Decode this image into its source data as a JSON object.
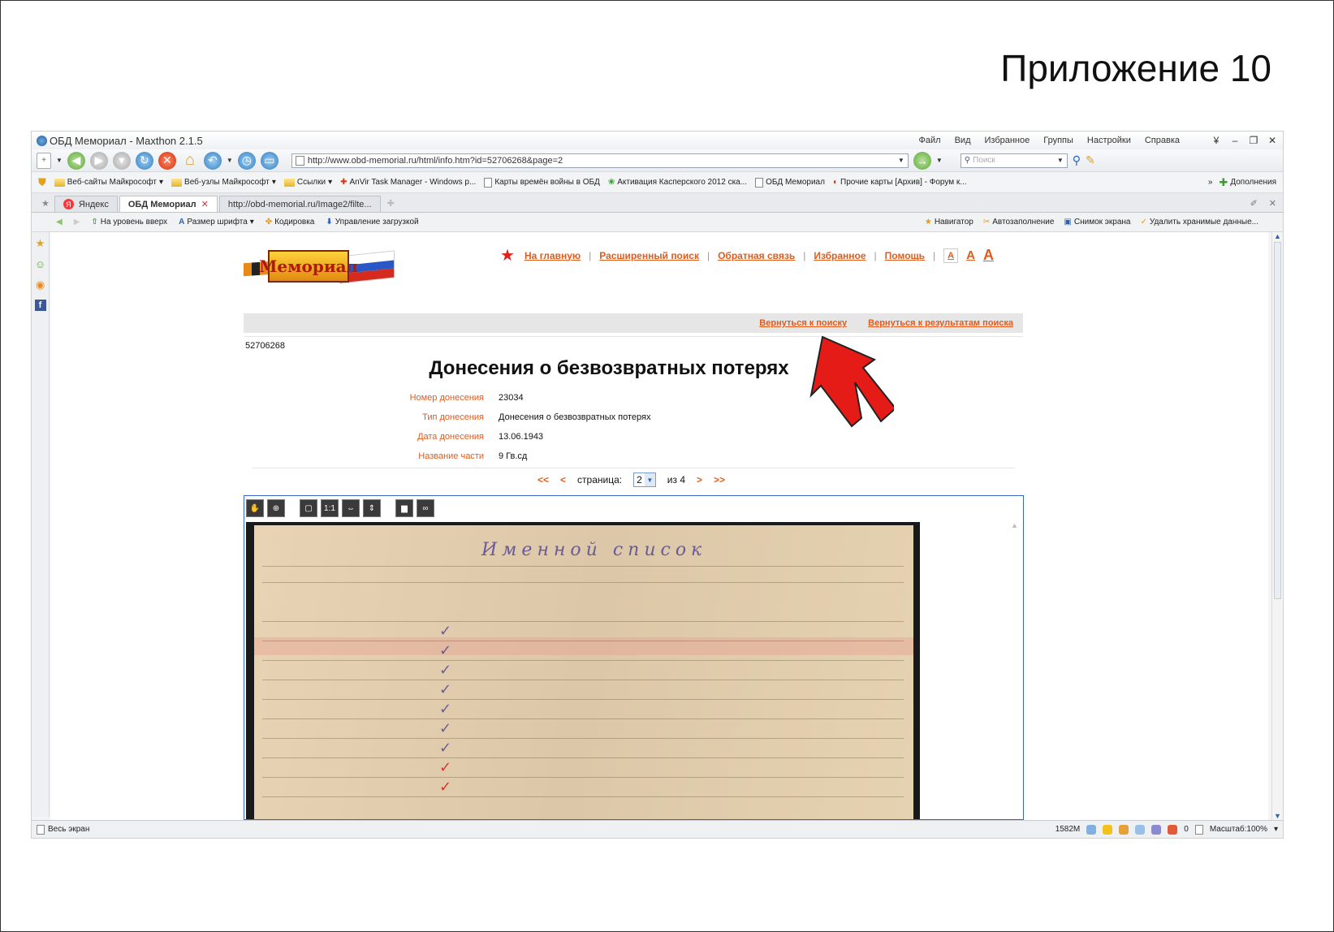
{
  "slide": {
    "title": "Приложение 10"
  },
  "browser": {
    "window_title": "ОБД Мемориал - Maxthon 2.1.5",
    "menu": [
      "Файл",
      "Вид",
      "Избранное",
      "Группы",
      "Настройки",
      "Справка"
    ],
    "address": "http://www.obd-memorial.ru/html/info.htm?id=52706268&page=2",
    "search_placeholder": "Поиск",
    "bookmarks": [
      "Веб-сайты Майкрософт",
      "Веб-узлы Майкрософт",
      "Ссылки",
      "AnVir Task Manager - Windows p...",
      "Карты времён войны в ОБД",
      "Активация Касперского 2012 ска...",
      "ОБД Мемориал",
      "Прочие карты [Архив] - Форум к..."
    ],
    "bookmarks_extra": "Дополнения",
    "tabs": [
      {
        "label": "Яндекс"
      },
      {
        "label": "ОБД Мемориал",
        "active": true
      },
      {
        "label": "http://obd-memorial.ru/Image2/filte..."
      }
    ],
    "navbar_left": [
      "На уровень вверх",
      "Размер шрифта",
      "Кодировка",
      "Управление загрузкой"
    ],
    "navbar_right": [
      "Навигатор",
      "Автозаполнение",
      "Снимок экрана",
      "Удалить хранимые данные..."
    ],
    "status": {
      "left": "Весь экран",
      "memory": "1582M",
      "counter": "0",
      "zoom": "Масштаб:100%"
    }
  },
  "site": {
    "logo_text": "Мемориал",
    "nav": [
      "На главную",
      "Расширенный поиск",
      "Обратная связь",
      "Избранное",
      "Помощь"
    ],
    "font_sizes": [
      "А",
      "А",
      "А"
    ],
    "back_search": "Вернуться к поиску",
    "back_results": "Вернуться к результатам поиска",
    "record_id": "52706268",
    "heading": "Донесения о безвозвратных потерях",
    "fields": [
      {
        "label": "Номер донесения",
        "value": "23034"
      },
      {
        "label": "Тип донесения",
        "value": "Донесения о безвозвратных потерях"
      },
      {
        "label": "Дата донесения",
        "value": "13.06.1943"
      },
      {
        "label": "Название части",
        "value": "9 Гв.сд"
      }
    ],
    "pager": {
      "first": "<<",
      "prev": "<",
      "label": "страница:",
      "current": "2",
      "of": "из 4",
      "next": ">",
      "last": ">>"
    },
    "doc_title": "Именной список"
  },
  "colors": {
    "link_orange": "#e35a1a",
    "arrow_red": "#e41b17",
    "viewer_border": "#3b64c9"
  }
}
